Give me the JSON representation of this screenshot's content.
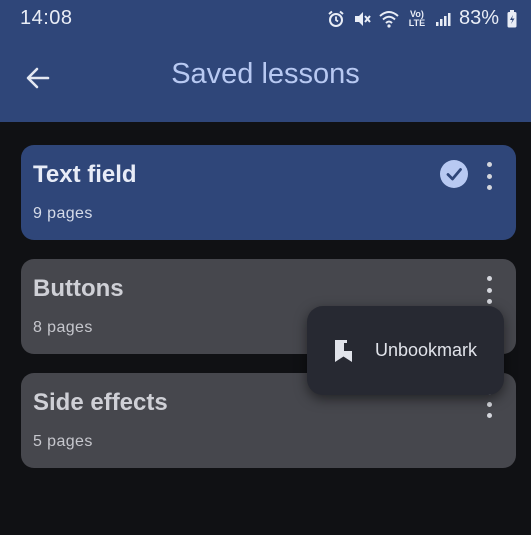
{
  "status_bar": {
    "time": "14:08",
    "network_label": "Vo) LTE",
    "battery_percent": "83%"
  },
  "app_bar": {
    "title": "Saved lessons",
    "back_icon": "arrow-left-icon"
  },
  "lessons": [
    {
      "name": "Text field",
      "pages": "9 pages",
      "selected": true
    },
    {
      "name": "Buttons",
      "pages": "8 pages",
      "selected": false
    },
    {
      "name": "Side effects",
      "pages": "5 pages",
      "selected": false
    }
  ],
  "context_menu": {
    "items": [
      {
        "label": "Unbookmark",
        "icon": "bookmark-remove-icon"
      }
    ]
  },
  "colors": {
    "app_bar_bg": "#2f4679",
    "title": "#b8c9f2",
    "card_bg": "#46474d",
    "selected_card_bg": "#2f4679",
    "menu_bg": "#272932",
    "screen_bg": "#101114"
  }
}
